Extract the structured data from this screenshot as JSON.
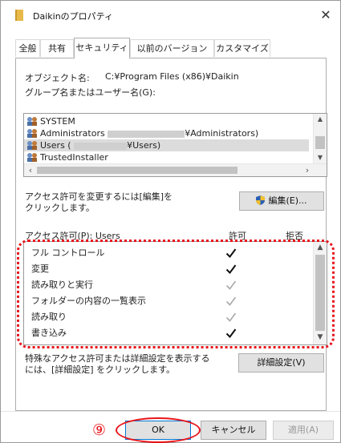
{
  "window": {
    "title": "Daikinのプロパティ",
    "close_glyph": "✕"
  },
  "tabs": [
    {
      "label": "全般"
    },
    {
      "label": "共有"
    },
    {
      "label": "セキュリティ",
      "active": true
    },
    {
      "label": "以前のバージョン"
    },
    {
      "label": "カスタマイズ"
    }
  ],
  "security": {
    "object_name_label": "オブジェクト名:",
    "object_name_value": "C:¥Program Files (x86)¥Daikin",
    "group_label": "グループ名またはユーザー名(G):",
    "users": [
      {
        "prefix": "SYSTEM",
        "suffix": "",
        "redacted": false
      },
      {
        "prefix": "Administrators",
        "suffix": "¥Administrators)",
        "redacted": true
      },
      {
        "prefix": "Users (",
        "suffix": "¥Users)",
        "redacted": true,
        "selected": true
      },
      {
        "prefix": "TrustedInstaller",
        "suffix": "",
        "redacted": false
      }
    ],
    "change_note_line1": "アクセス許可を変更するには[編集]を",
    "change_note_line2": "クリックします。",
    "edit_button": "編集(E)...",
    "perm_header": "アクセス許可(P): Users",
    "allow_header": "許可",
    "deny_header": "拒否",
    "permissions": [
      {
        "name": "フル コントロール",
        "allow": "✓",
        "inherited": false
      },
      {
        "name": "変更",
        "allow": "✓",
        "inherited": false
      },
      {
        "name": "読み取りと実行",
        "allow": "✓",
        "inherited": true
      },
      {
        "name": "フォルダーの内容の一覧表示",
        "allow": "✓",
        "inherited": true
      },
      {
        "name": "読み取り",
        "allow": "✓",
        "inherited": true
      },
      {
        "name": "書き込み",
        "allow": "✓",
        "inherited": false
      }
    ],
    "advanced_note_line1": "特殊なアクセス許可または詳細設定を表示する",
    "advanced_note_line2": "には、[詳細設定] をクリックします。",
    "advanced_button": "詳細設定(V)"
  },
  "footer": {
    "step_number": "⑨",
    "ok_button": "OK",
    "cancel_button": "キャンセル",
    "apply_button": "適用(A)"
  },
  "colors": {
    "annotation_red": "#e8141b",
    "primary_border": "#0078d7"
  }
}
